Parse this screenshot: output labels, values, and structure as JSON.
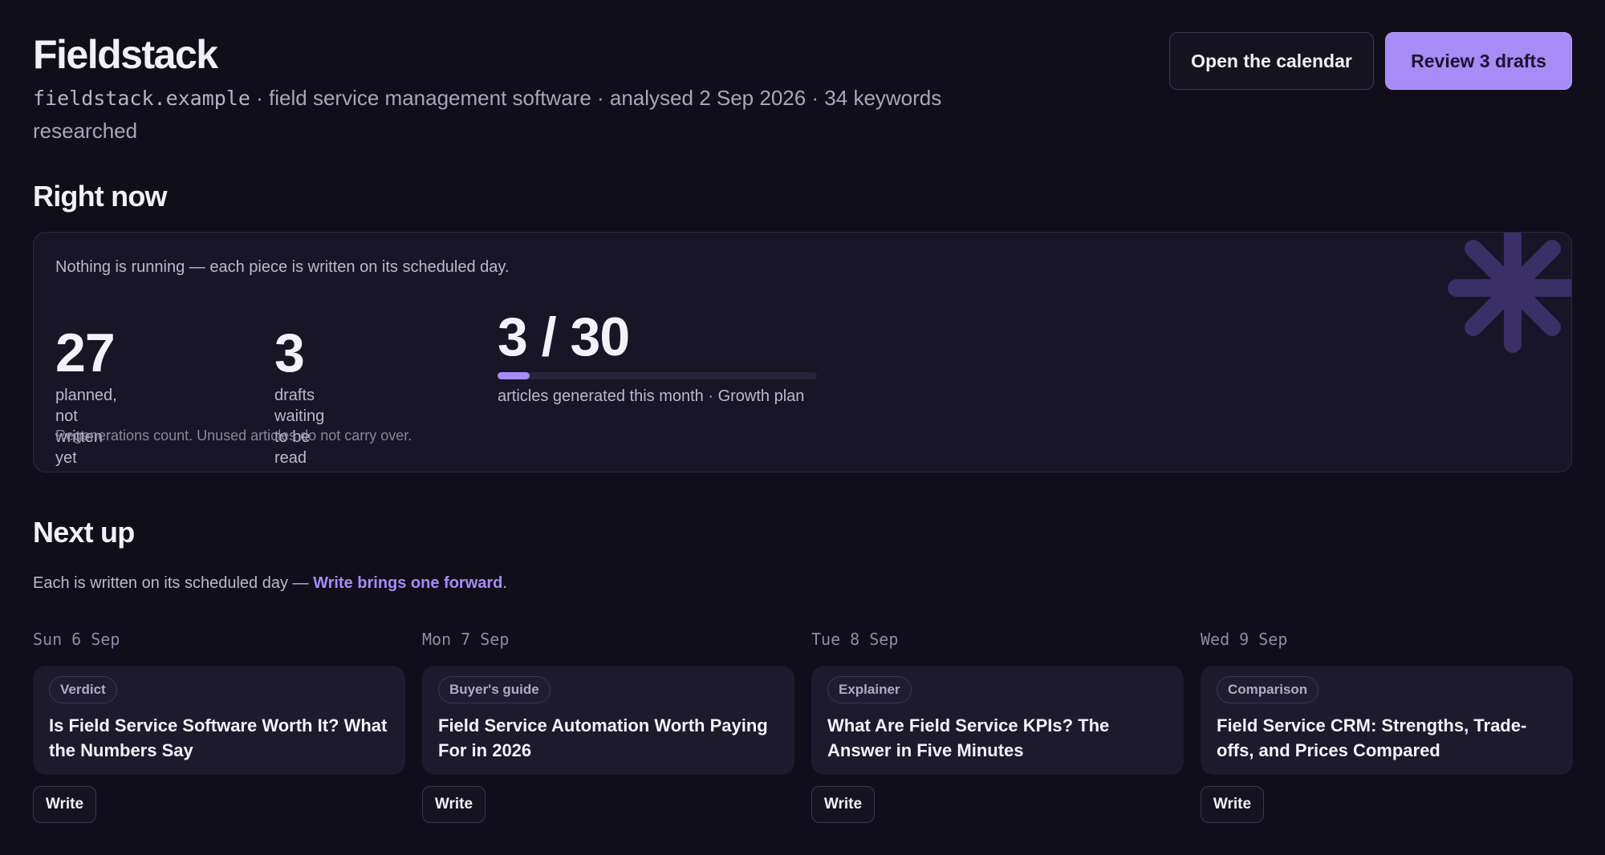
{
  "header": {
    "title": "Fieldstack",
    "domain": "fieldstack.example",
    "meta": " · field service management software · analysed 2 Sep 2026 · 34 keywords researched",
    "open_calendar_label": "Open the calendar",
    "review_drafts_label": "Review 3 drafts"
  },
  "right_now": {
    "heading": "Right now",
    "status": "Nothing is running — each piece is written on its scheduled day.",
    "stats": [
      {
        "value": "27",
        "label": "planned, not written yet"
      },
      {
        "value": "3",
        "label": "drafts waiting to be read"
      },
      {
        "value": "3 / 30",
        "label": "articles generated this month · Growth plan"
      }
    ],
    "usage": {
      "used": 3,
      "limit": 30
    },
    "footnote": "Regenerations count. Unused articles do not carry over.",
    "decor_icon": "asterisk-icon"
  },
  "next_up": {
    "heading": "Next up",
    "desc_prefix": "Each is written on its scheduled day — ",
    "desc_strong": "Write brings one forward",
    "desc_suffix": ".",
    "items": [
      {
        "day": "Sun 6 Sep",
        "tag": "Verdict",
        "title": "Is Field Service Software Worth It? What the Numbers Say",
        "action": "Write"
      },
      {
        "day": "Mon 7 Sep",
        "tag": "Buyer's guide",
        "title": "Field Service Automation Worth Paying For in 2026",
        "action": "Write"
      },
      {
        "day": "Tue 8 Sep",
        "tag": "Explainer",
        "title": "What Are Field Service KPIs? The Answer in Five Minutes",
        "action": "Write"
      },
      {
        "day": "Wed 9 Sep",
        "tag": "Comparison",
        "title": "Field Service CRM: Strengths, Trade-offs, and Prices Compared",
        "action": "Write"
      }
    ]
  },
  "colors": {
    "background": "#100e1b",
    "panel": "#181527",
    "card": "#1d1a2d",
    "accent": "#a78bf6",
    "text": "#f1f0f8",
    "muted": "#bcb8cf"
  }
}
